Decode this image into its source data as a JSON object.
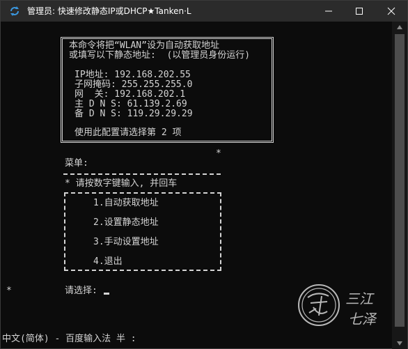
{
  "window": {
    "title": "管理员:  快速修改静态IP或DHCP★Tanken·L"
  },
  "info": {
    "line1": "本命令将把“WLAN”设为自动获取地址",
    "line2": "或填写以下静态地址:  (以管理员身份运行)",
    "ip": "IP地址: 192.168.202.55",
    "mask": "子网掩码: 255.255.255.0",
    "gateway": "网  关: 192.168.202.1",
    "dns1": "主 D N S: 61.139.2.69",
    "dns2": "备 D N S: 119.29.29.29",
    "hint": "使用此配置请选择第 2 项"
  },
  "menu": {
    "star_top": "*",
    "title": "菜单:",
    "instruction": "* 请按数字键输入, 并回车",
    "items": [
      "1.自动获取地址",
      "2.设置静态地址",
      "3.手动设置地址",
      "4.退出"
    ]
  },
  "prompt": {
    "star": "*",
    "label": "请选择:"
  },
  "ime": {
    "status": "中文(简体) - 百度输入法 半 :"
  },
  "watermark": {
    "text1": "三江",
    "text2": "七泽"
  },
  "colors": {
    "console_bg": "#0c0c0c",
    "console_fg": "#d4d4d4",
    "titlebar_bg": "#2b2b2b",
    "icon_blue": "#3a96dd"
  }
}
